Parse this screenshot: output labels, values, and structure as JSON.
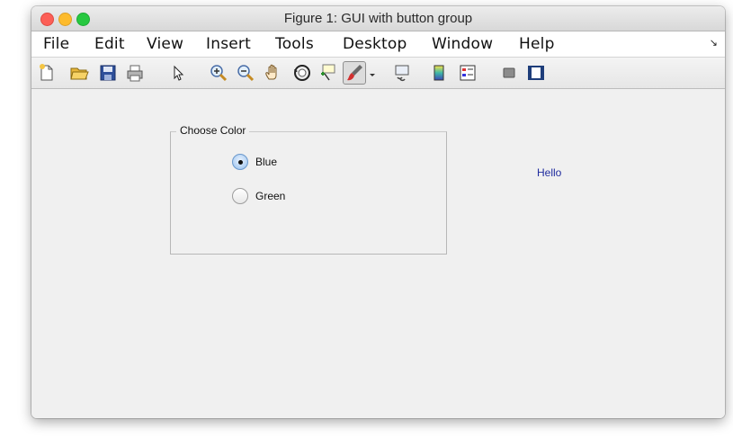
{
  "window": {
    "title": "Figure 1: GUI with button group"
  },
  "menu": {
    "items": [
      "File",
      "Edit",
      "View",
      "Insert",
      "Tools",
      "Desktop",
      "Window",
      "Help"
    ],
    "overflow_icon": "dock-arrow-icon"
  },
  "toolbar": {
    "icons": [
      "new-figure-icon",
      "open-file-icon",
      "save-icon",
      "print-icon",
      "pointer-icon",
      "zoom-in-icon",
      "zoom-out-icon",
      "pan-hand-icon",
      "rotate-3d-icon",
      "data-cursor-icon",
      "brush-icon",
      "brush-dropdown-icon",
      "link-plot-icon",
      "insert-colorbar-icon",
      "insert-legend-icon",
      "hide-plot-tools-icon",
      "show-plot-tools-icon"
    ]
  },
  "button_group": {
    "title": "Choose Color",
    "options": [
      {
        "label": "Blue",
        "selected": true
      },
      {
        "label": "Green",
        "selected": false
      }
    ]
  },
  "text_label": {
    "value": "Hello",
    "color": "#1f2b9e"
  },
  "colors": {
    "close": "#fc5f57",
    "minimize": "#fdbb2d",
    "maximize": "#27c840",
    "canvas": "#f0f0f0"
  }
}
